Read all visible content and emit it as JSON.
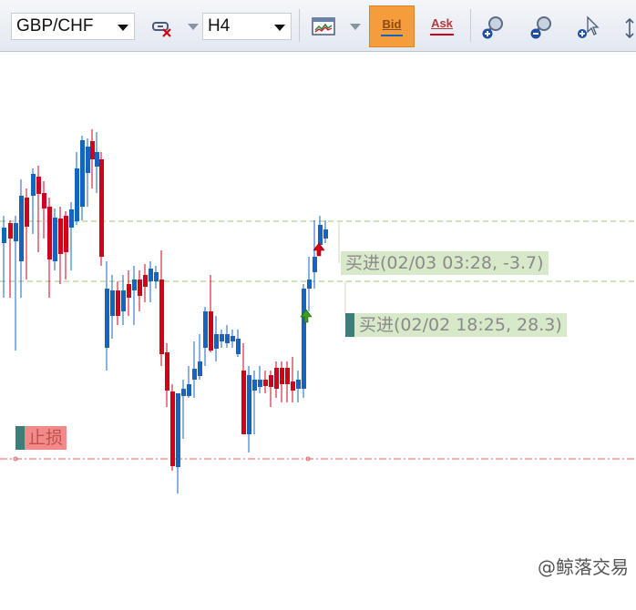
{
  "toolbar": {
    "symbol": "GBP/CHF",
    "timeframe": "H4",
    "bid_label": "Bid",
    "ask_label": "Ask",
    "icons": [
      "link-remove-icon",
      "chart-template-icon",
      "zoom-in-icon",
      "zoom-out-icon",
      "crosshair-cursor-icon",
      "vertical-resize-icon"
    ]
  },
  "orders": [
    {
      "label": "买进(02/03 03:28, -3.7)",
      "color": "#d8e9c9"
    },
    {
      "label": "买进(02/02 18:25, 28.3)",
      "color": "#d8e9c9"
    }
  ],
  "stop_loss": {
    "label": "止损",
    "color": "#f28a8a"
  },
  "watermark": "@鲸落交易",
  "colors": {
    "bull": "#1565c0",
    "bear": "#d0021b",
    "entry_line": "#9cc27a",
    "stop_line": "#e06060"
  }
}
